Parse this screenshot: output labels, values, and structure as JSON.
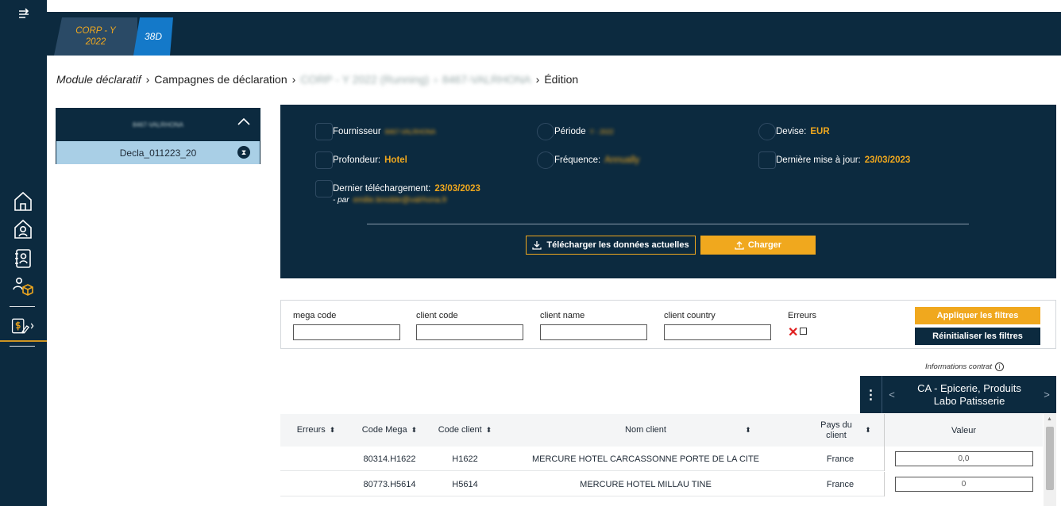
{
  "rail": {
    "toggle_icon": "menu-toggle-icon",
    "items": [
      "home-icon",
      "user-home-icon",
      "contacts-book-icon",
      "user-box-icon",
      "declaration-icon"
    ]
  },
  "top_tabs": {
    "corp_label": "CORP - Y 2022",
    "corp_line1": "CORP - Y",
    "corp_line2": "2022",
    "code_label": "38D"
  },
  "breadcrumb": {
    "module": "Module déclaratif",
    "campaigns": "Campagnes de déclaration",
    "campaign_name": "CORP - Y 2022 (Running)",
    "supplier": "8467-VALRHONA",
    "current": "Édition",
    "separator": "›"
  },
  "declaration_panel": {
    "supplier": "8467-VALRHONA",
    "item_label": "Decla_011223_20",
    "status_icon": "hourglass-icon"
  },
  "info": {
    "fournisseur_label": "Fournisseur",
    "fournisseur_value": "8467-VALRHONA",
    "periode_label": "Période",
    "periode_value": "Y - 2022",
    "devise_label": "Devise:",
    "devise_value": "EUR",
    "profondeur_label": "Profondeur:",
    "profondeur_value": "Hotel",
    "frequence_label": "Fréquence:",
    "frequence_value": "Annually",
    "maj_label": "Dernière mise à jour:",
    "maj_value": "23/03/2023",
    "telechargement_label": "Dernier téléchargement:",
    "telechargement_value": "23/03/2023",
    "par_label": "- par",
    "par_value": "emilie.lenoble@valrhona.fr",
    "download_button": "Télécharger les données actuelles",
    "upload_button": "Charger"
  },
  "filters": {
    "mega_code": "mega code",
    "client_code": "client code",
    "client_name": "client name",
    "client_country": "client country",
    "errors": "Erreurs",
    "apply": "Appliquer les filtres",
    "reset": "Réinitialiser les filtres"
  },
  "contract": {
    "info_label": "Informations contrat",
    "title_line1": "CA - Epicerie, Produits",
    "title_line2": "Labo Patisserie",
    "prev": "<",
    "next": ">"
  },
  "table": {
    "headers": {
      "errors": "Erreurs",
      "code_mega": "Code Mega",
      "code_client": "Code client",
      "nom_client": "Nom client",
      "pays_line1": "Pays du",
      "pays_line2": "client",
      "valeur": "Valeur"
    },
    "rows": [
      {
        "code_mega": "80314.H1622",
        "code_client": "H1622",
        "nom_client": "MERCURE HOTEL CARCASSONNE PORTE DE LA CITE",
        "pays": "France",
        "valeur": "0,0"
      },
      {
        "code_mega": "80773.H5614",
        "code_client": "H5614",
        "nom_client": "MERCURE HOTEL MILLAU TINE",
        "pays": "France",
        "valeur": "0"
      }
    ]
  }
}
